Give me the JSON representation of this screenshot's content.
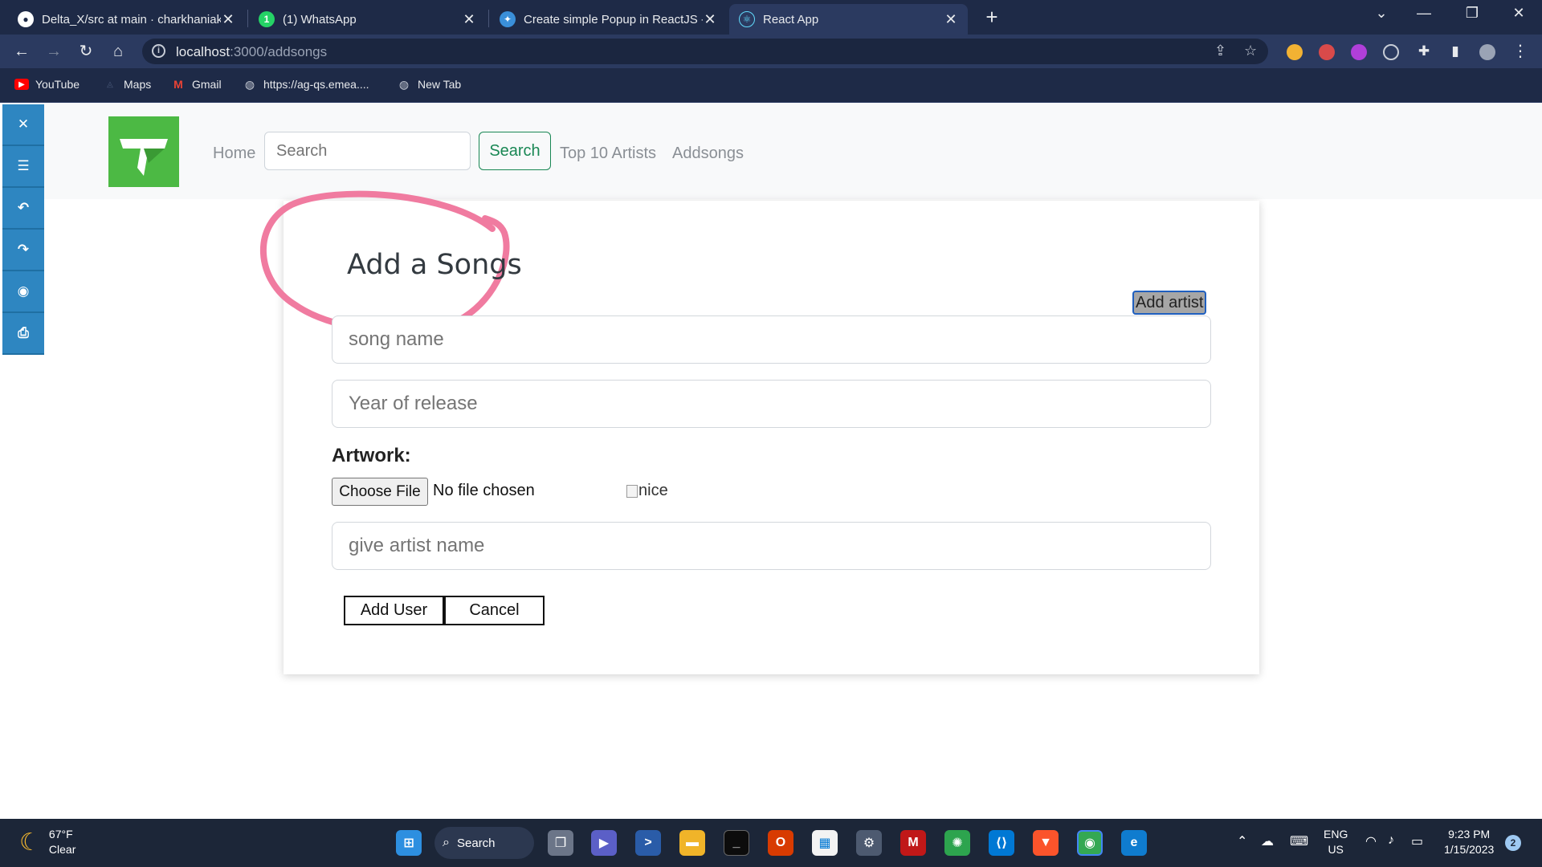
{
  "browser": {
    "tabs": [
      {
        "title": "Delta_X/src at main · charkhaniak",
        "icon": "github-icon"
      },
      {
        "title": "(1) WhatsApp",
        "icon": "whatsapp-icon"
      },
      {
        "title": "Create simple Popup in ReactJS -",
        "icon": "site-icon"
      },
      {
        "title": "React App",
        "icon": "react-icon"
      }
    ],
    "url_host": "localhost",
    "url_path": ":3000/addsongs",
    "bookmarks": [
      {
        "label": "YouTube",
        "icon": "youtube-icon"
      },
      {
        "label": "Maps",
        "icon": "maps-icon"
      },
      {
        "label": "Gmail",
        "icon": "gmail-icon"
      },
      {
        "label": "https://ag-qs.emea....",
        "icon": "globe-icon"
      },
      {
        "label": "New Tab",
        "icon": "globe-icon"
      }
    ]
  },
  "navbar": {
    "home": "Home",
    "search_placeholder": "Search",
    "search_button": "Search",
    "top_artists": "Top 10 Artists",
    "addsongs": "Addsongs"
  },
  "form": {
    "title": "Add a Songs",
    "add_artist_button": "Add artist",
    "song_name_placeholder": "song name",
    "year_placeholder": "Year of release",
    "artwork_label": "Artwork:",
    "choose_file_button": "Choose File",
    "no_file_text": "No file chosen",
    "image_alt": "nice",
    "artist_placeholder": "give artist name",
    "add_user_button": "Add User",
    "cancel_button": "Cancel"
  },
  "taskbar": {
    "weather_temp": "67°F",
    "weather_desc": "Clear",
    "search_label": "Search",
    "lang_1": "ENG",
    "lang_2": "US",
    "time": "9:23 PM",
    "date": "1/15/2023",
    "notifications": "2"
  },
  "colors": {
    "chrome_dark": "#1e2a47",
    "chrome_active": "#2b3a60",
    "logo_green": "#4cb944",
    "search_green": "#198754",
    "tool_blue": "#2e86c1",
    "scribble_pink": "#f07ba0"
  }
}
